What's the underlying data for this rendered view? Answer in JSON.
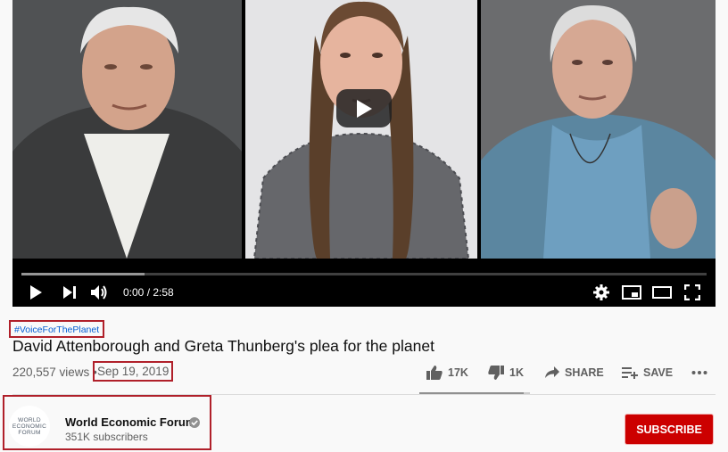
{
  "player": {
    "time": "0:00 / 2:58",
    "progress_loaded_fraction": 0.18,
    "icons": [
      "play-icon",
      "next-icon",
      "volume-icon",
      "settings-icon",
      "miniplayer-icon",
      "theater-icon",
      "fullscreen-icon"
    ]
  },
  "video": {
    "hashtag": "#VoiceForThePlanet",
    "title": "David Attenborough and Greta Thunberg's plea for the planet",
    "views": "220,557 views",
    "separator": "•",
    "date": "Sep 19, 2019"
  },
  "actions": {
    "likes": "17K",
    "dislikes": "1K",
    "share": "SHARE",
    "save": "SAVE",
    "like_fraction": 0.94
  },
  "channel": {
    "name": "World Economic Forum",
    "subscribers": "351K subscribers",
    "logo_lines": [
      "WORLD",
      "ECONOMIC",
      "FORUM"
    ],
    "subscribe_label": "SUBSCRIBE"
  },
  "colors": {
    "subscribe": "#cc0000",
    "annotation_box": "#b0202a",
    "hashtag": "#065fd4"
  }
}
